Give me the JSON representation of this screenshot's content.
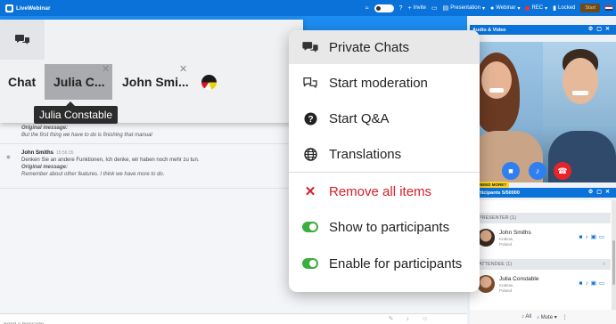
{
  "app": {
    "name": "LiveWebinar"
  },
  "topbar": {
    "invite": "Invite",
    "presentation": "Presentation",
    "webinar": "Webinar",
    "rec": "REC",
    "locked": "Locked",
    "start": "Start"
  },
  "chat": {
    "tabs": [
      {
        "label": "Chat"
      },
      {
        "label": "Julia C..."
      },
      {
        "label": "John Smi..."
      }
    ],
    "tooltip": "Julia Constable",
    "fragment": {
      "orig_label": "Original message:",
      "orig_text": "But the first thing we have to do is finishing that manual"
    },
    "messages": [
      {
        "name": "John Smiths",
        "time": "15:56:35",
        "text": "Denken Sie an andere Funktionen, Ich denke, wir haben noch mehr zu tun.",
        "orig_label": "Original message:",
        "orig_text": "Remember about other features. I think we have more to do."
      }
    ],
    "input_placeholder": "Send a message..."
  },
  "menu": {
    "items": [
      {
        "label": "Private Chats",
        "icon": "chats-icon"
      },
      {
        "label": "Start moderation",
        "icon": "moderation-icon"
      },
      {
        "label": "Start Q&A",
        "icon": "question-icon"
      },
      {
        "label": "Translations",
        "icon": "globe-icon"
      },
      {
        "label": "Remove all items",
        "icon": "close-icon"
      },
      {
        "label": "Show to participants",
        "icon": "toggle-icon"
      },
      {
        "label": "Enable for participants",
        "icon": "toggle-icon"
      }
    ]
  },
  "right": {
    "audio_video_title": "Audio & Video",
    "need_more": "NEED MORE?",
    "participants_title": "Participants 5/50000",
    "presenter_section": "PRESENTER (1)",
    "attendee_section": "ATTENDEE (1)",
    "presenter": {
      "name": "John Smiths",
      "city": "Krakow,",
      "country": "Poland"
    },
    "attendee": {
      "name": "Julia Constable",
      "city": "Krakow,",
      "country": "Poland"
    },
    "all_label": "All",
    "mute_label": "Mute"
  },
  "colors": {
    "brand": "#1d8df2",
    "topbar": "#0a72d9",
    "danger": "#d31f2a",
    "toggle_on": "#3cae3f"
  }
}
